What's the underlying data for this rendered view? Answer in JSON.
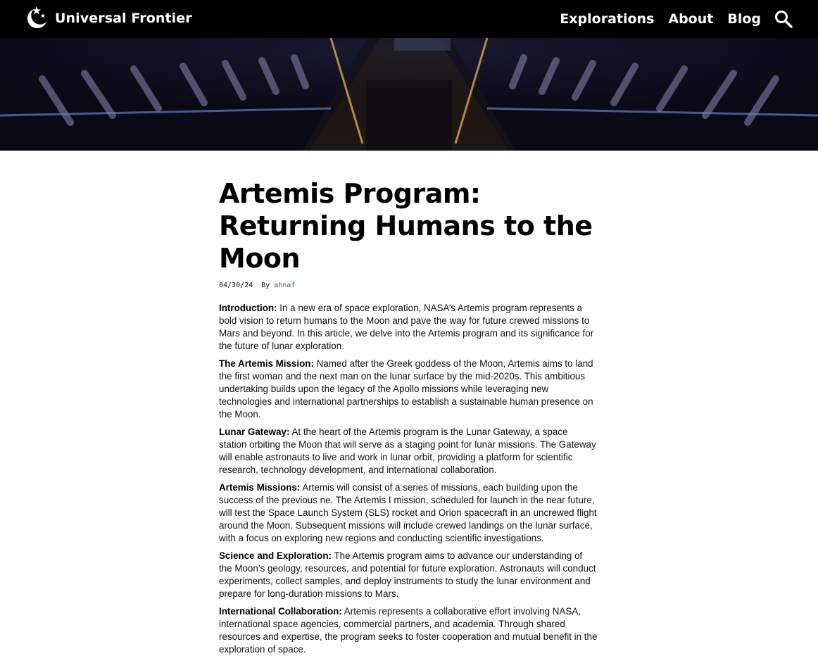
{
  "header": {
    "brand_name": "Universal Frontier",
    "nav": [
      {
        "label": "Explorations"
      },
      {
        "label": "About"
      },
      {
        "label": "Blog"
      }
    ]
  },
  "article": {
    "title": "Artemis Program: Returning Humans to the Moon",
    "date": "04/30/24",
    "by_label": "By",
    "author": "ahnaf",
    "sections": [
      {
        "heading": "Introduction:",
        "body": " In a new era of space exploration, NASA’s Artemis program represents a bold vision to return humans to the Moon and pave the way for future crewed missions to Mars and beyond. In this article, we delve into the Artemis program and its significance for the future of lunar exploration."
      },
      {
        "heading": "The Artemis Mission:",
        "body": " Named after the Greek goddess of the Moon, Artemis aims to land the first woman and the next man on the lunar surface by the mid-2020s. This ambitious undertaking builds upon the legacy of the Apollo missions while leveraging new technologies and international partnerships to establish a sustainable human presence on the Moon."
      },
      {
        "heading": "Lunar Gateway:",
        "body": " At the heart of the Artemis program is the Lunar Gateway, a space station orbiting the Moon that will serve as a staging point for lunar missions. The Gateway will enable astronauts to live and work in lunar orbit, providing a platform for scientific research, technology development, and international collaboration."
      },
      {
        "heading": "Artemis Missions:",
        "body": " Artemis will consist of a series of missions, each building upon the success of the previous ne. The Artemis I mission, scheduled for launch in the near future, will test the Space Launch System (SLS) rocket and Orion spacecraft in an uncrewed flight around the Moon. Subsequent missions will include crewed landings on the lunar surface, with a focus on exploring new regions and conducting scientific investigations."
      },
      {
        "heading": "Science and Exploration:",
        "body": " The Artemis program aims to advance our understanding of the Moon’s geology, resources, and potential for future exploration. Astronauts will conduct experiments, collect samples, and deploy instruments to study the lunar environment and prepare for long-duration missions to Mars."
      },
      {
        "heading": "International Collaboration:",
        "body": " Artemis represents a collaborative effort involving NASA, international space agencies, commercial partners, and academia. Through shared resources and expertise, the program seeks to foster cooperation and mutual benefit in the exploration of space."
      }
    ]
  },
  "icons": {
    "logo": "moon-stars-icon",
    "search": "search-icon"
  },
  "colors": {
    "header_bg": "#000000",
    "header_text": "#ffffff",
    "page_bg": "#ffffff",
    "author_link": "#2a5a8a"
  }
}
